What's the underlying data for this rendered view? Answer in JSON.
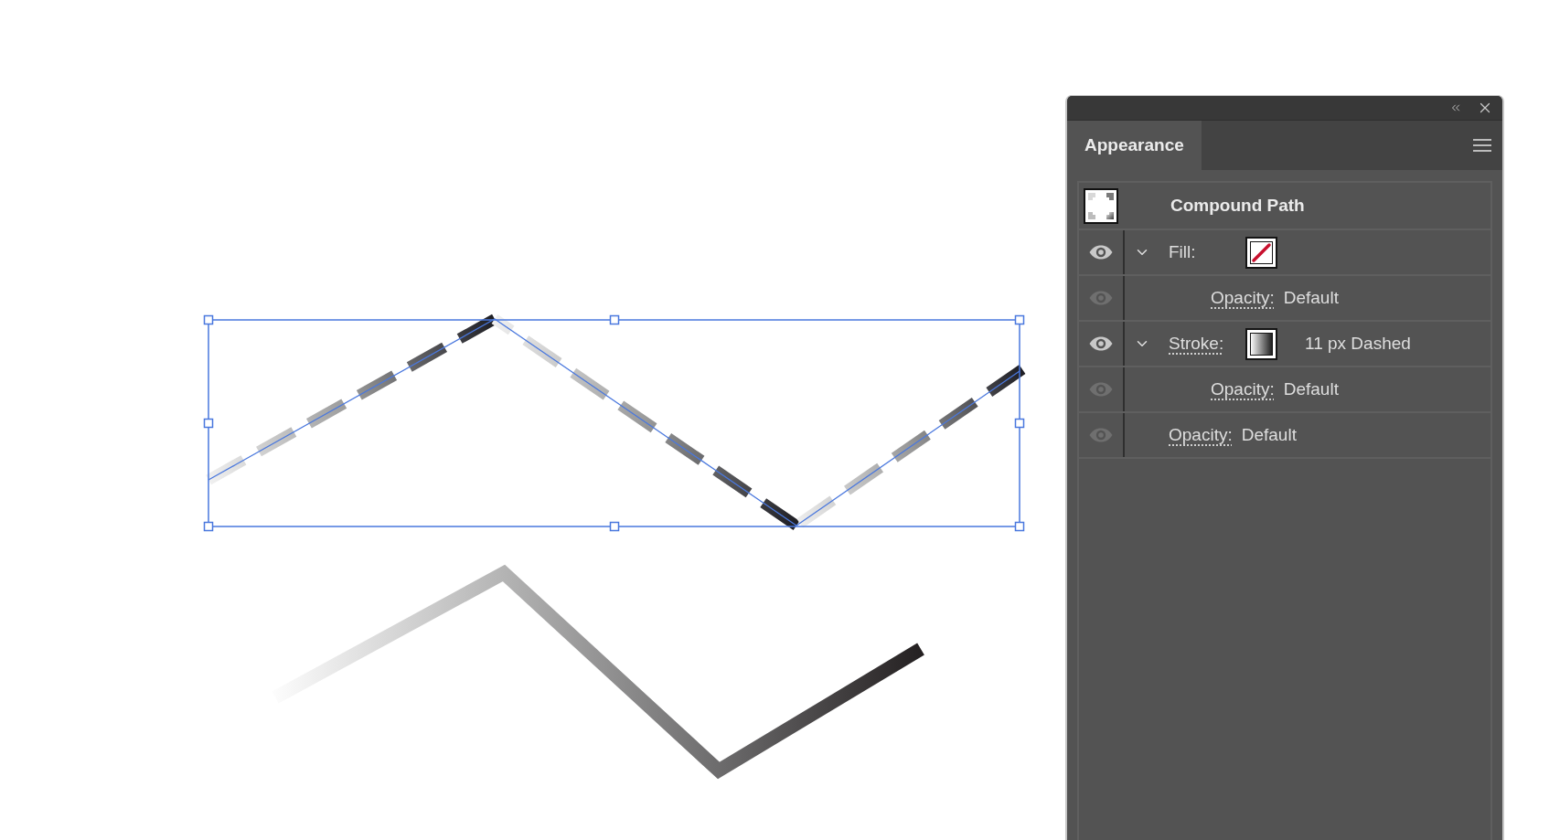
{
  "panel": {
    "tab": {
      "label": "Appearance",
      "selected": true
    },
    "object": {
      "label": "Compound Path"
    },
    "rows": [
      {
        "kind": "attribute",
        "label": "Fill:",
        "link": false,
        "eye_on": true,
        "expanded": true,
        "swatch": {
          "kind": "none"
        },
        "children": [
          {
            "kind": "opacity",
            "label": "Opacity:",
            "link": true,
            "eye_on": false,
            "value": "Default"
          }
        ]
      },
      {
        "kind": "attribute",
        "label": "Stroke:",
        "link": true,
        "eye_on": true,
        "expanded": true,
        "swatch": {
          "kind": "gradient"
        },
        "value": "11 px Dashed",
        "children": [
          {
            "kind": "opacity",
            "label": "Opacity:",
            "link": true,
            "eye_on": false,
            "value": "Default"
          }
        ]
      },
      {
        "kind": "opacity",
        "label": "Opacity:",
        "link": true,
        "eye_on": false,
        "value": "Default"
      }
    ]
  }
}
